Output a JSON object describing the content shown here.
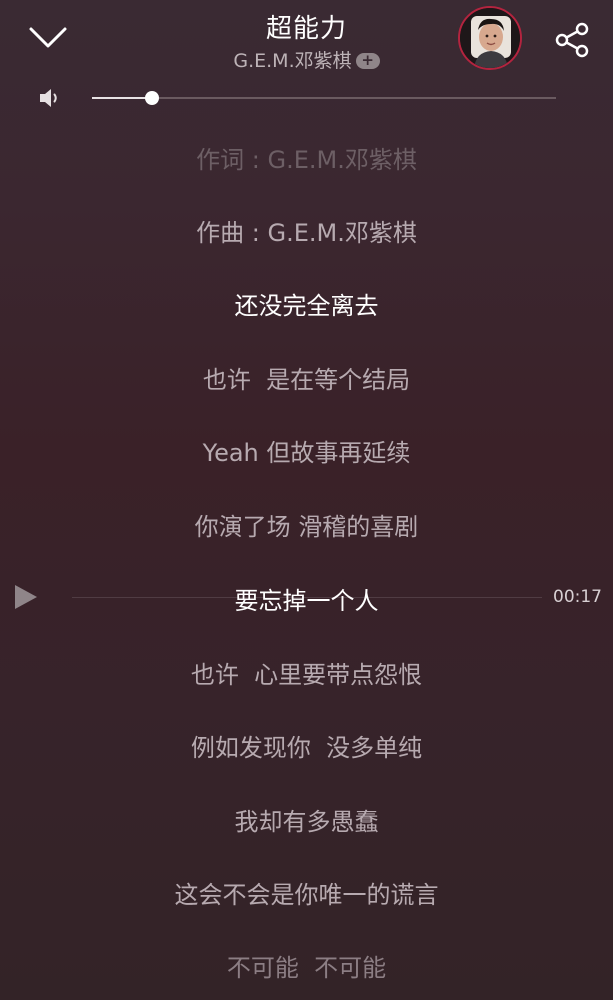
{
  "header": {
    "title": "超能力",
    "artist": "G.E.M.邓紫棋",
    "follow_label": "+"
  },
  "icons": {
    "back": "chevron-down-icon",
    "share": "share-icon",
    "volume": "volume-icon",
    "play": "play-icon",
    "avatar": "artist-avatar"
  },
  "volume": {
    "level": 0.13
  },
  "lyrics": [
    {
      "text": "作词 : G.E.M.邓紫棋",
      "state": "faded"
    },
    {
      "text": "作曲 : G.E.M.邓紫棋",
      "state": "normal"
    },
    {
      "text": "还没完全离去",
      "state": "current"
    },
    {
      "text": "也许  是在等个结局",
      "state": "normal"
    },
    {
      "text": "Yeah 但故事再延续",
      "state": "normal"
    },
    {
      "text": "你演了场 滑稽的喜剧",
      "state": "normal"
    },
    {
      "text": "要忘掉一个人",
      "state": "current"
    },
    {
      "text": "也许  心里要带点怨恨",
      "state": "normal"
    },
    {
      "text": "例如发现你  没多单纯",
      "state": "normal"
    },
    {
      "text": "我却有多愚蠢",
      "state": "normal"
    },
    {
      "text": "这会不会是你唯一的谎言",
      "state": "normal"
    },
    {
      "text": "不可能  不可能",
      "state": "dim"
    }
  ],
  "seek": {
    "time": "00:17"
  },
  "colors": {
    "accent": "#b3243f",
    "current_line": "#ffffff",
    "lyric": "#b7aab0"
  }
}
